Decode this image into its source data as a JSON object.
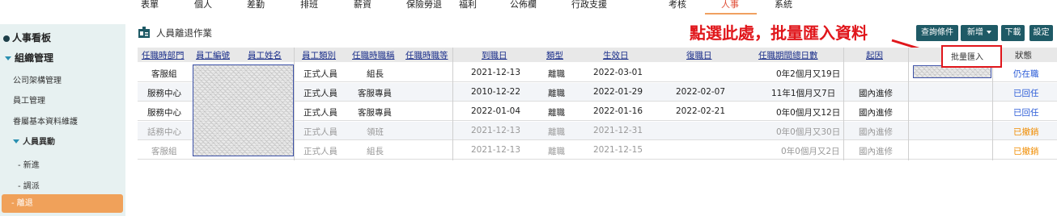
{
  "topnav": {
    "items": [
      "表單",
      "個人",
      "差勤",
      "排班",
      "薪資",
      "保險勞退",
      "福利",
      "公佈欄",
      "行政支援",
      "考核",
      "人事",
      "系統"
    ],
    "active_index": 10
  },
  "sidebar": {
    "section": "人事看板",
    "group": "組織管理",
    "items": [
      "公司架構管理",
      "員工管理",
      "眷屬基本資料維護"
    ],
    "subgroup": "人員異動",
    "subitems": [
      "- 新進",
      "- 調派",
      "- 離退"
    ]
  },
  "page": {
    "title": "人員離退作業",
    "annotation": "點選此處，批量匯入資料"
  },
  "toolbar": {
    "query": "查詢條件",
    "add": "新增",
    "download": "下載",
    "settings": "設定",
    "dropdown_item": "批量匯入"
  },
  "table": {
    "headers": [
      "任職時部門",
      "員工編號",
      "員工姓名",
      "員工類別",
      "任職時職稱",
      "任職時職等",
      "到職日",
      "類型",
      "生效日",
      "復職日",
      "任職期間總日數",
      "起因",
      "",
      "狀態"
    ],
    "rows": [
      {
        "dept": "客服組",
        "type": "正式人員",
        "title": "組長",
        "hire": "2021-12-13",
        "kind": "離職",
        "effective": "2022-03-01",
        "return": "",
        "days": "0年2個月又19日",
        "reason": "",
        "status": "仍在職"
      },
      {
        "dept": "服務中心",
        "type": "正式人員",
        "title": "客服專員",
        "hire": "2010-12-22",
        "kind": "離職",
        "effective": "2022-01-29",
        "return": "2022-02-07",
        "days": "11年1個月又7日",
        "reason": "國內進修",
        "status": "已回任"
      },
      {
        "dept": "服務中心",
        "type": "正式人員",
        "title": "客服專員",
        "hire": "2022-01-04",
        "kind": "離職",
        "effective": "2022-01-16",
        "return": "2022-02-21",
        "days": "0年0個月又12日",
        "reason": "國內進修",
        "status": "已回任"
      },
      {
        "dept": "話務中心",
        "type": "正式人員",
        "title": "領班",
        "hire": "2021-12-13",
        "kind": "離職",
        "effective": "2021-12-31",
        "return": "",
        "days": "0年0個月又30日",
        "reason": "國內進修",
        "status": "已撤銷"
      },
      {
        "dept": "客服組",
        "type": "正式人員",
        "title": "組長",
        "hire": "2021-12-13",
        "kind": "離職",
        "effective": "2021-12-15",
        "return": "",
        "days": "0年0個月又2日",
        "reason": "國內進修",
        "status": "已撤銷"
      }
    ]
  },
  "colors": {
    "nav_active": "#e0513a",
    "sidebar_bg": "#e7f1f1",
    "sidebar_active": "#f0a15a",
    "button": "#1f5a66",
    "annotation": "#e0161b",
    "link": "#1a2e8a",
    "status_blue": "#2a5bd7",
    "status_orange": "#f08c00"
  }
}
